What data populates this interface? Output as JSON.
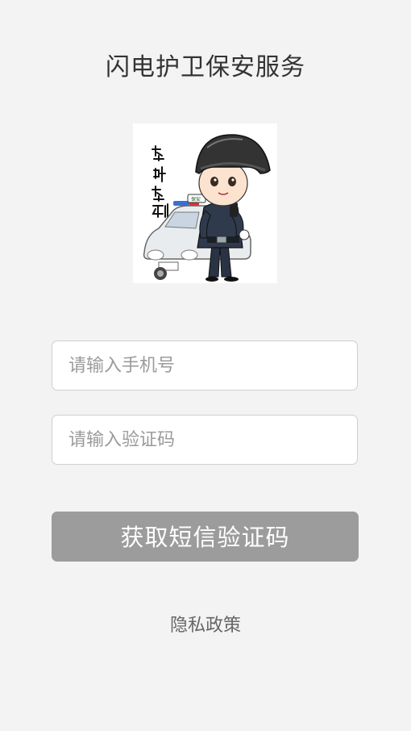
{
  "app": {
    "title": "闪电护卫保安服务"
  },
  "logo": {
    "slogan": "随叫随到",
    "badge": "保安",
    "description": "cartoon-security-guard-with-car"
  },
  "form": {
    "phone_placeholder": "请输入手机号",
    "phone_value": "",
    "code_placeholder": "请输入验证码",
    "code_value": "",
    "submit_label": "获取短信验证码"
  },
  "footer": {
    "privacy_label": "隐私政策"
  },
  "colors": {
    "background": "#f3f3f3",
    "button": "#9c9c9c",
    "button_text": "#ffffff",
    "title_text": "#333333",
    "placeholder": "#9b9b9b"
  }
}
